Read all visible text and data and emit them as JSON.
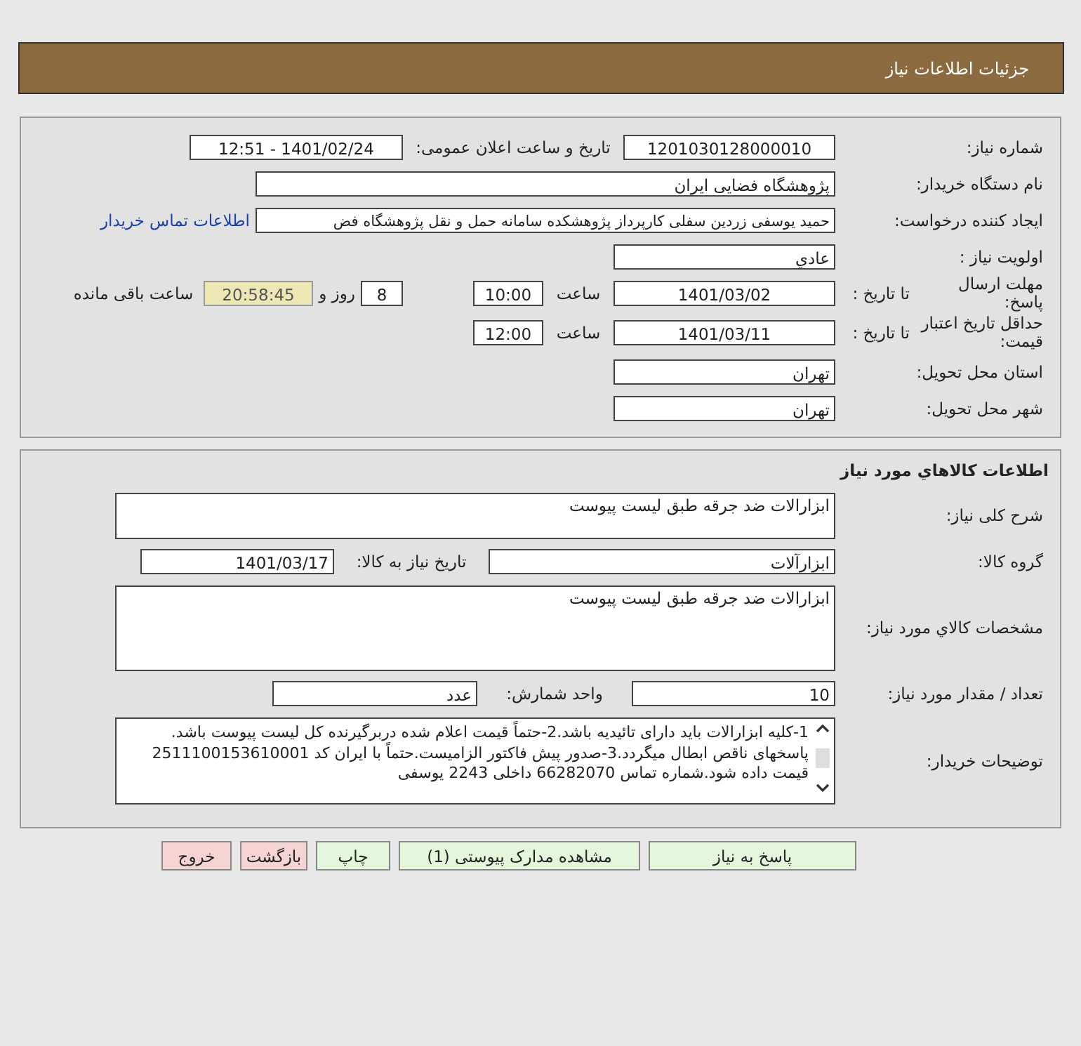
{
  "header": {
    "title": "جزئیات اطلاعات نیاز"
  },
  "need": {
    "number": {
      "label": "شماره نیاز:",
      "value": "1201030128000010"
    },
    "announce": {
      "label": "تاریخ و ساعت اعلان عمومی:",
      "value": "1401/02/24 - 12:51"
    },
    "buyer": {
      "label": "نام دستگاه خریدار:",
      "value": "پژوهشگاه فضایی ایران"
    },
    "creator": {
      "label": "ایجاد کننده درخواست:",
      "value": "حمید یوسفی زردین سفلی کارپرداز پژوهشکده سامانه حمل و نقل پژوهشگاه فض",
      "link": "اطلاعات تماس خریدار"
    },
    "priority": {
      "label": "اولویت نیاز :",
      "value": "عادي"
    },
    "deadline": {
      "label": "مهلت ارسال پاسخ:",
      "to_label": "تا تاریخ :",
      "date": "1401/03/02",
      "time_label": "ساعت",
      "time": "10:00",
      "days": "8",
      "days_label": "روز و",
      "remaining": "20:58:45",
      "remaining_label": "ساعت باقی مانده"
    },
    "validity": {
      "label": "حداقل تاریخ اعتبار قیمت:",
      "to_label": "تا تاریخ :",
      "date": "1401/03/11",
      "time_label": "ساعت",
      "time": "12:00"
    },
    "province": {
      "label": "استان محل تحویل:",
      "value": "تهران"
    },
    "city": {
      "label": "شهر محل تحویل:",
      "value": "تهران"
    }
  },
  "goods": {
    "title": "اطلاعات کالاهاي مورد نياز",
    "summary": {
      "label": "شرح کلی نیاز:",
      "value": "ابزارالات ضد جرقه طبق لیست پیوست"
    },
    "group": {
      "label": "گروه کالا:",
      "value": "ابزارآلات",
      "date_label": "تاریخ نیاز به کالا:",
      "date": "1401/03/17"
    },
    "specs": {
      "label": "مشخصات کالاي مورد نياز:",
      "value": "ابزارالات ضد جرقه طبق لیست پیوست"
    },
    "quantity": {
      "label": "تعداد / مقدار مورد نیاز:",
      "value": "10",
      "unit_label": "واحد شمارش:",
      "unit": "عدد"
    },
    "notes": {
      "label": "توضیحات خریدار:",
      "value": "1-کلیه ابزارالات باید دارای تائیدیه باشد.2-حتماً قیمت اعلام شده دربرگیرنده کل لیست پیوست باشد. پاسخهای ناقص ابطال میگردد.3-صدور پیش فاکتور الزامیست.حتماً با ایران کد 2511100153610001 قیمت داده شود.شماره تماس 66282070 داخلی 2243 یوسفی"
    }
  },
  "buttons": [
    {
      "label": "پاسخ به نیاز",
      "kind": "primary"
    },
    {
      "label": "مشاهده مدارک پیوستی (1)",
      "kind": "primary"
    },
    {
      "label": "چاپ",
      "kind": "primary"
    },
    {
      "label": "بازگشت",
      "kind": "danger"
    },
    {
      "label": "خروج",
      "kind": "danger"
    }
  ]
}
